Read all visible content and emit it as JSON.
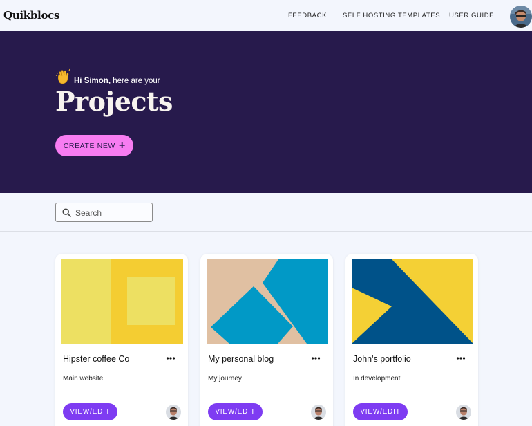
{
  "app": {
    "logo": "Quikblocs"
  },
  "nav": {
    "items": [
      {
        "label": "FEEDBACK"
      },
      {
        "label": "SELF HOSTING TEMPLATES"
      },
      {
        "label": "USER GUIDE"
      }
    ]
  },
  "hero": {
    "greeting_name": "Hi Simon,",
    "greeting_rest": " here are your",
    "title": "Projects",
    "create_label": "CREATE NEW",
    "background": "#271a4c",
    "create_color": "#f77cf1"
  },
  "search": {
    "placeholder": "Search"
  },
  "projects": [
    {
      "title": "Hipster coffee Co",
      "description": "Main website",
      "button": "VIEW/EDIT"
    },
    {
      "title": "My personal blog",
      "description": "My journey",
      "button": "VIEW/EDIT"
    },
    {
      "title": "John's portfolio",
      "description": "In development",
      "button": "VIEW/EDIT"
    }
  ],
  "colors": {
    "accent": "#7e3cf2",
    "yellow": "#f4d035",
    "blue": "#0199c6",
    "navy": "#005289",
    "tan": "#e0c0a2"
  }
}
